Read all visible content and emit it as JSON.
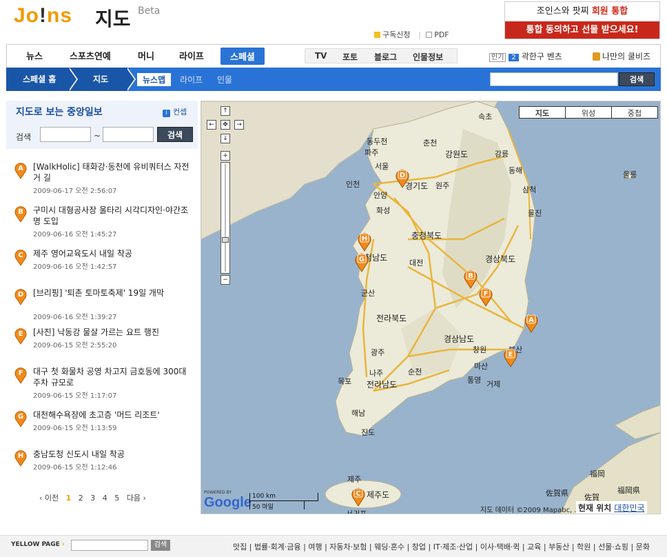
{
  "header": {
    "logo": "JOINS",
    "title": "지도",
    "beta": "Beta",
    "link_subscribe": "구독신청",
    "link_pdf": "PDF",
    "ad_line1_prefix": "조인스와 팟찌 ",
    "ad_line1_highlight": "회원 통합",
    "ad_line2": "통합 동의하고 선물 받으세요!"
  },
  "mainnav": {
    "items": [
      "뉴스",
      "스포츠연예",
      "머니",
      "라이프",
      "스페셜"
    ],
    "sub_items": [
      "TV",
      "포토",
      "블로그",
      "인물정보"
    ],
    "popular_badge": "인기",
    "popular_rank": "2",
    "popular_text": "곽한구 벤츠",
    "quiz": "나만의 쿨비즈"
  },
  "subnav": {
    "crumbs": [
      "스페셜 홈",
      "지도"
    ],
    "tabs": [
      "뉴스맵",
      "라이프",
      "인물"
    ],
    "search_button": "검색"
  },
  "left": {
    "title": "지도로 보는 중앙일보",
    "content_link": "컨셉",
    "search_label": "검색",
    "tilde": "~",
    "search_button": "검색",
    "news": [
      {
        "marker": "A",
        "title": "[WalkHolic] 태화강·동천에 유비쿼터스 자전거 길",
        "date": "2009-06-17 오전 2:56:07"
      },
      {
        "marker": "B",
        "title": "구미시 대형공사장 울타리 시각디자인·야간조명 도입",
        "date": "2009-06-16 오전 1:45:27"
      },
      {
        "marker": "C",
        "title": "제주 영어교육도시 내일 착공",
        "date": "2009-06-16 오전 1:42:57"
      },
      {
        "marker": "D",
        "title": "[브리핑] '퇴촌 토마토축제' 19일 개막",
        "date": "2009-06-16 오전 1:39:27"
      },
      {
        "marker": "E",
        "title": "[사진] 낙동강 물살 가르는 요트 행진",
        "date": "2009-06-15 오전 2:55:20"
      },
      {
        "marker": "F",
        "title": "대구 첫 화물차 공영 차고지 금호동에 300대 주차 규모로",
        "date": "2009-06-15 오전 1:17:07"
      },
      {
        "marker": "G",
        "title": "대천해수욕장에 초고층 '머드 리조트'",
        "date": "2009-06-15 오전 1:13:59"
      },
      {
        "marker": "H",
        "title": "충남도청 신도시 내일 착공",
        "date": "2009-06-15 오전 1:12:46"
      }
    ],
    "pager": {
      "prev": "‹ 이전",
      "pages": [
        "1",
        "2",
        "3",
        "4",
        "5"
      ],
      "next": "다음 ›",
      "current": "1"
    }
  },
  "map": {
    "buttons": [
      "지도",
      "위성",
      "중첩"
    ],
    "labels": [
      {
        "text": "속초"
      },
      {
        "text": "동두천"
      },
      {
        "text": "춘천"
      },
      {
        "text": "파주"
      },
      {
        "text": "강원도"
      },
      {
        "text": "강릉"
      },
      {
        "text": "서울"
      },
      {
        "text": "동해"
      },
      {
        "text": "인천"
      },
      {
        "text": "경기도"
      },
      {
        "text": "원주"
      },
      {
        "text": "울릉"
      },
      {
        "text": "안양"
      },
      {
        "text": "삼척"
      },
      {
        "text": "화성"
      },
      {
        "text": "울진"
      },
      {
        "text": "충청북도"
      },
      {
        "text": "충청남도"
      },
      {
        "text": "대전"
      },
      {
        "text": "경상북도"
      },
      {
        "text": "군산"
      },
      {
        "text": "전라북도"
      },
      {
        "text": "경상남도"
      },
      {
        "text": "창원"
      },
      {
        "text": "마산"
      },
      {
        "text": "부산"
      },
      {
        "text": "광주"
      },
      {
        "text": "나주"
      },
      {
        "text": "순천"
      },
      {
        "text": "통영"
      },
      {
        "text": "거제"
      },
      {
        "text": "목포"
      },
      {
        "text": "전라남도"
      },
      {
        "text": "해남"
      },
      {
        "text": "진도"
      },
      {
        "text": "제주"
      },
      {
        "text": "제주도"
      },
      {
        "text": "서귀포"
      },
      {
        "text": "福岡"
      },
      {
        "text": "佐賀県"
      },
      {
        "text": "佐賀"
      },
      {
        "text": "福岡県"
      }
    ],
    "markers": [
      "A",
      "B",
      "C",
      "D",
      "E",
      "F",
      "G",
      "H"
    ],
    "powered": "POWERED BY",
    "google": "Google",
    "scale_km": "100 km",
    "scale_mi": "50 마일",
    "copyright": "지도 데이터 ©2009 Mapabc, ...",
    "current_location_label": "현재 위치",
    "current_location_value": "대한민국",
    "colors": {
      "land": "#e8e4d4",
      "sea": "#99b3cc",
      "road": "#e8b63c",
      "marker": "#f28a1a"
    }
  },
  "footer": {
    "yellowpage": "YELLOW PAGE",
    "search_button": "검색",
    "categories": "맛집 | 법률·회계·금융 | 여행 | 자동차·보험 | 웨딩·혼수 | 창업 | IT·제조·산업 | 이사·택배·퀵 | 교육 | 부동산 | 학원 | 선물·쇼핑 | 문화"
  }
}
